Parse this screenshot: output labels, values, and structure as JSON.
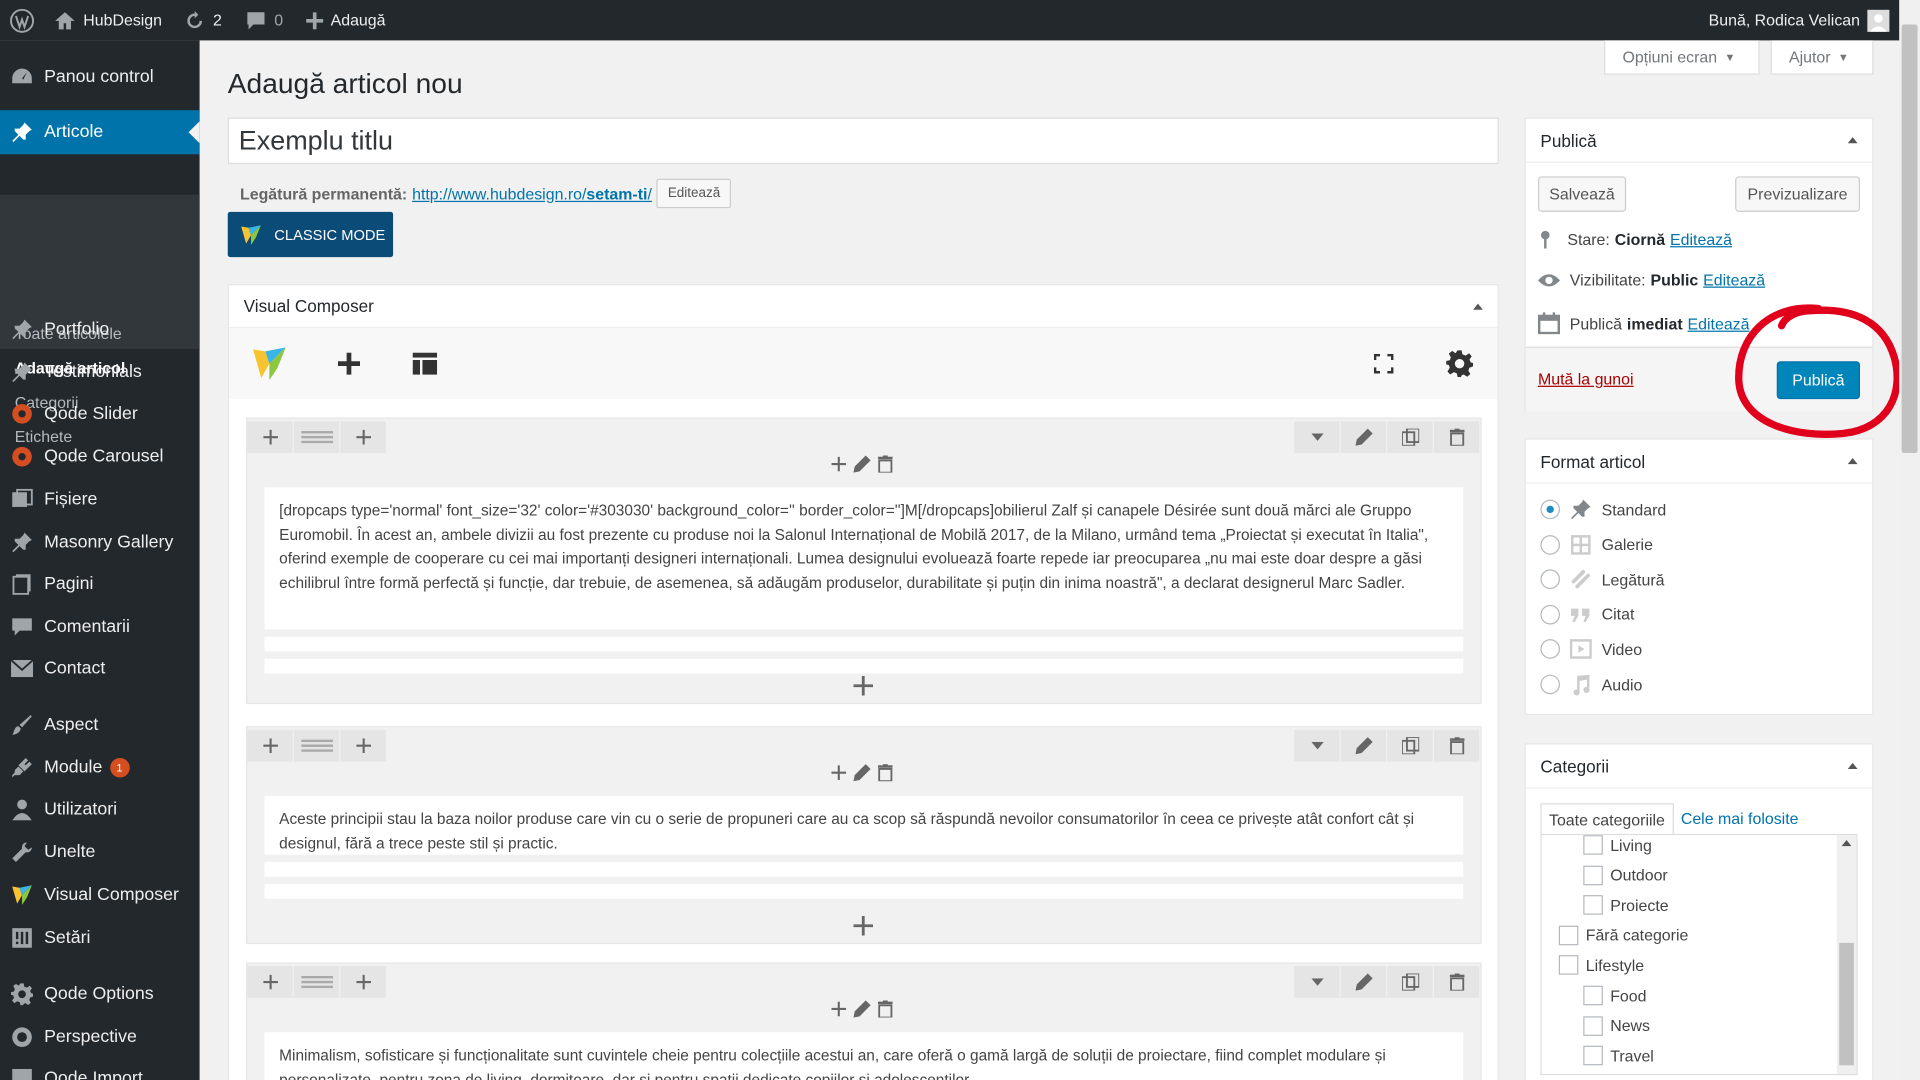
{
  "adminbar": {
    "site_name": "HubDesign",
    "updates_count": "2",
    "comments_count": "0",
    "new_label": "Adaugă",
    "greeting": "Bună, Rodica Velican"
  },
  "sidebar": {
    "items": [
      {
        "label": "Panou control",
        "icon": "dashboard-icon"
      },
      {
        "label": "Articole",
        "icon": "pin-icon"
      },
      {
        "label": "Portfolio",
        "icon": "pin-icon"
      },
      {
        "label": "Testimonials",
        "icon": "pin-icon"
      },
      {
        "label": "Qode Slider",
        "icon": "circle-icon"
      },
      {
        "label": "Qode Carousel",
        "icon": "circle-icon"
      },
      {
        "label": "Fișiere",
        "icon": "media-icon"
      },
      {
        "label": "Masonry Gallery",
        "icon": "pin-icon"
      },
      {
        "label": "Pagini",
        "icon": "page-icon"
      },
      {
        "label": "Comentarii",
        "icon": "comment-icon"
      },
      {
        "label": "Contact",
        "icon": "mail-icon"
      },
      {
        "label": "Aspect",
        "icon": "brush-icon"
      },
      {
        "label": "Module",
        "icon": "plugin-icon",
        "badge": "1"
      },
      {
        "label": "Utilizatori",
        "icon": "user-icon"
      },
      {
        "label": "Unelte",
        "icon": "wrench-icon"
      },
      {
        "label": "Visual Composer",
        "icon": "vc-icon"
      },
      {
        "label": "Setări",
        "icon": "settings-icon"
      },
      {
        "label": "Qode Options",
        "icon": "gear-icon"
      },
      {
        "label": "Perspective",
        "icon": "perspective-icon"
      },
      {
        "label": "Qode Import",
        "icon": "import-icon"
      }
    ],
    "submenu": [
      "Toate articolele",
      "Adaugă articol",
      "Categorii",
      "Etichete"
    ]
  },
  "screen_options": {
    "options_label": "Opțiuni ecran",
    "help_label": "Ajutor"
  },
  "page_title": "Adaugă articol nou",
  "post": {
    "title": "Exemplu titlu",
    "permalink_label": "Legătură permanentă:",
    "permalink_base": "http://www.hubdesign.ro/",
    "permalink_slug": "setam-ti",
    "permalink_tail": "/",
    "edit_permalink": "Editează"
  },
  "classic_mode_label": "CLASSIC MODE",
  "visual_composer": {
    "title": "Visual Composer",
    "rows": [
      {
        "text": "[dropcaps type='normal' font_size='32' color='#303030' background_color='' border_color='']M[/dropcaps]obilierul Zalf și canapele Désirée sunt două mărci ale Gruppo Euromobil. În acest an, ambele divizii au fost prezente cu produse noi la Salonul Internațional de Mobilă 2017, de la Milano, urmând tema „Proiectat și executat în Italia\", oferind exemple de cooperare cu cei mai importanți designeri internaționali. Lumea designului evoluează foarte repede iar preocuparea „nu mai este doar despre a găsi echilibrul între formă perfectă și funcție, dar trebuie, de asemenea, să adăugăm produselor, durabilitate și puțin din inima noastră\", a declarat designerul Marc Sadler."
      },
      {
        "text": "Aceste principii stau la baza noilor produse care vin cu o serie de propuneri care au ca scop să răspundă nevoilor consumatorilor în ceea ce privește atât confort cât și designul, fără a trece peste stil și practic."
      },
      {
        "text": "Minimalism, sofisticare și funcționalitate sunt cuvintele cheie pentru colecțiile acestui an, care oferă o gamă largă de soluții de proiectare, fiind complet modulare și personalizate, pentru zona de living, dormitoare, dar și pentru spații dedicate copiilor și adolescentilor."
      }
    ]
  },
  "publish_box": {
    "title": "Publică",
    "save_label": "Salvează",
    "preview_label": "Previzualizare",
    "status_label": "Stare:",
    "status_value": "Ciornă",
    "visibility_label": "Vizibilitate:",
    "visibility_value": "Public",
    "schedule_label": "Publică",
    "schedule_value": "imediat",
    "edit_link": "Editează",
    "trash_label": "Mută la gunoi",
    "publish_label": "Publică",
    "annotation_color": "#e0001b"
  },
  "format_box": {
    "title": "Format articol",
    "options": [
      "Standard",
      "Galerie",
      "Legătură",
      "Citat",
      "Video",
      "Audio"
    ],
    "selected": "Standard"
  },
  "categories_box": {
    "title": "Categorii",
    "tab_all": "Toate categoriile",
    "tab_popular": "Cele mai folosite",
    "items": [
      {
        "label": "Living",
        "level": 1
      },
      {
        "label": "Outdoor",
        "level": 1
      },
      {
        "label": "Proiecte",
        "level": 1
      },
      {
        "label": "Fără categorie",
        "level": 0
      },
      {
        "label": "Lifestyle",
        "level": 0
      },
      {
        "label": "Food",
        "level": 1
      },
      {
        "label": "News",
        "level": 1
      },
      {
        "label": "Travel",
        "level": 1
      }
    ]
  },
  "colors": {
    "accent": "#0073aa",
    "sidebar": "#23282d",
    "publish": "#0085ba"
  }
}
